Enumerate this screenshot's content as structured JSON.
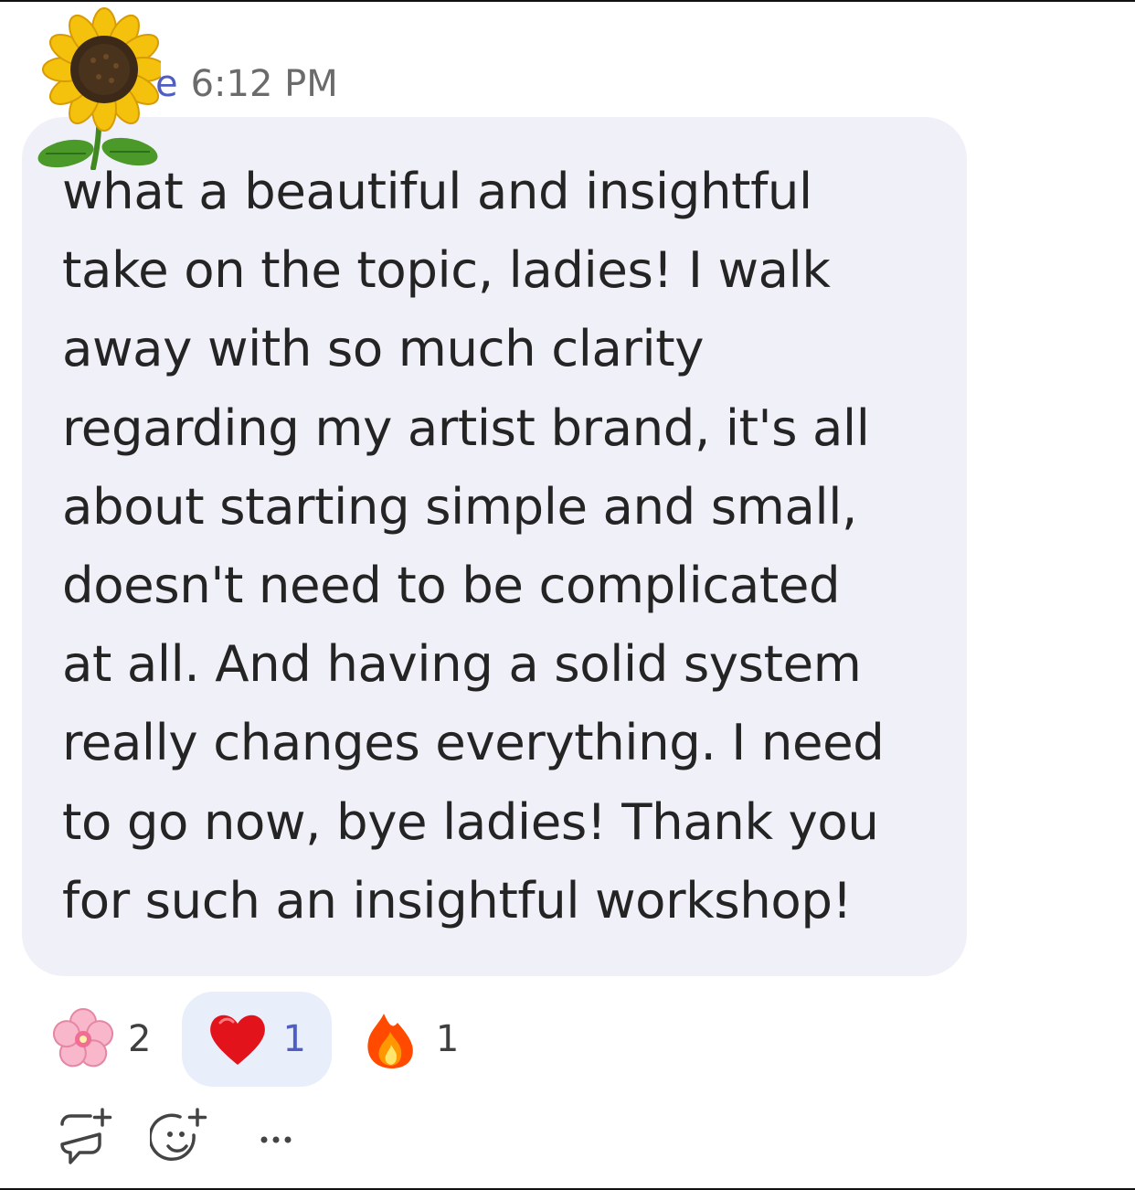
{
  "message": {
    "sender_fragment": "e",
    "timestamp": "6:12 PM",
    "body": "what a beautiful and insightful\ntake on the topic, ladies! I walk\naway with so much clarity\nregarding my artist brand, it's all\nabout starting simple and small,\ndoesn't need to be complicated\nat all. And having a solid system\nreally changes everything. I need\nto go now, bye ladies! Thank you\nfor such an insightful workshop!",
    "avatar_icon": "sunflower-icon"
  },
  "reactions": [
    {
      "icon": "cherry-blossom-icon",
      "count": "2",
      "selected": false
    },
    {
      "icon": "red-heart-icon",
      "count": "1",
      "selected": true
    },
    {
      "icon": "fire-icon",
      "count": "1",
      "selected": false
    }
  ],
  "actions": {
    "reply_icon": "reply-icon",
    "add_reaction_icon": "add-reaction-icon",
    "more_icon": "more-options-icon"
  },
  "colors": {
    "bubble_background": "#f0f0f8",
    "accent": "#4f5ec2",
    "selected_reaction_background": "#e9eefb",
    "text": "#242424",
    "timestamp": "#6b6b6b"
  }
}
